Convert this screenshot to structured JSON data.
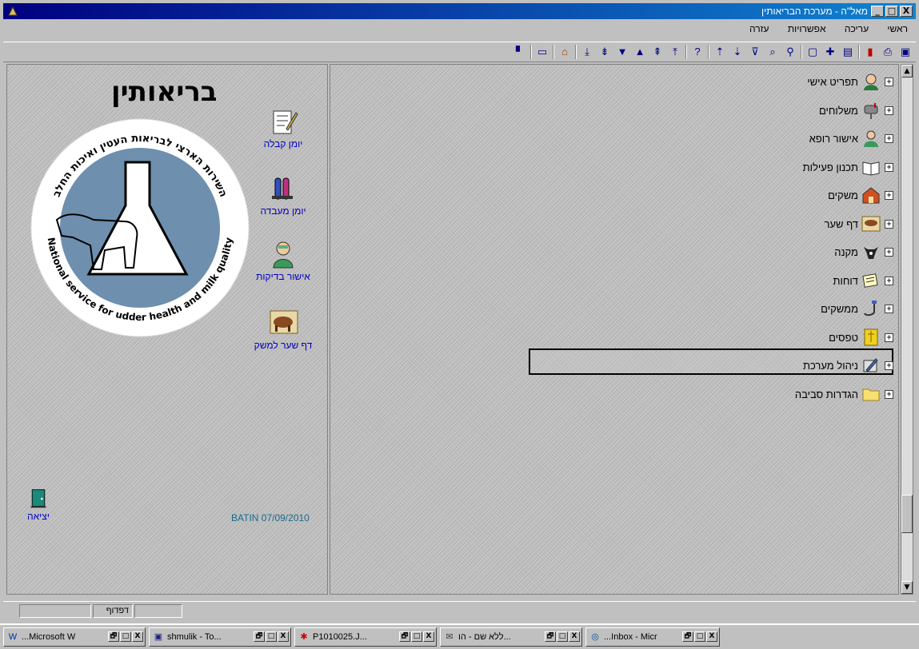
{
  "window": {
    "title": "מאל\"ה - מערכת הבריאותין",
    "buttons": {
      "minimize": "_",
      "maximize": "□",
      "close": "X"
    }
  },
  "menu": {
    "items": [
      "ראשי",
      "עריכה",
      "אפשרויות",
      "עזרה"
    ]
  },
  "toolbar": {
    "icons": [
      "window-icon",
      "print-preview-icon",
      "chart-icon",
      "note-icon",
      "new-icon",
      "document-icon",
      "filter-icon",
      "sort-desc-icon",
      "sort-asc-icon",
      "help-icon",
      "first-icon",
      "prev-page-icon",
      "up-icon",
      "down-icon",
      "next-page-icon",
      "last-icon",
      "home-icon",
      "display-icon",
      "bookmark-icon"
    ]
  },
  "left": {
    "brand_title": "בריאותין",
    "logo_text_outer": "השירות הארצי לבריאות העטין ואיכות החלב",
    "logo_text_english": "National service for udder health and milk quality",
    "shortcuts": [
      {
        "label": "יומן קבלה"
      },
      {
        "label": "יומן מעבדה"
      },
      {
        "label": "אישור בדיקות"
      },
      {
        "label": "דף שער למשק"
      }
    ],
    "status_date": "BATIN 07/09/2010",
    "exit_label": "יציאה"
  },
  "tree": {
    "items": [
      {
        "label": "תפריט אישי",
        "icon": "user-icon"
      },
      {
        "label": "משלוחים",
        "icon": "mailbox-icon"
      },
      {
        "label": "אישור רופא",
        "icon": "doctor-icon"
      },
      {
        "label": "תכנון פעילות",
        "icon": "book-icon"
      },
      {
        "label": "משקים",
        "icon": "barn-icon"
      },
      {
        "label": "דף שער",
        "icon": "cow-icon"
      },
      {
        "label": "מקנה",
        "icon": "cattle-icon"
      },
      {
        "label": "דוחות",
        "icon": "reports-icon"
      },
      {
        "label": "ממשקים",
        "icon": "interface-icon"
      },
      {
        "label": "טפסים",
        "icon": "forms-icon"
      },
      {
        "label": "ניהול מערכת",
        "icon": "admin-icon",
        "selected": true
      },
      {
        "label": "הגדרות סביבה",
        "icon": "folder-icon"
      }
    ],
    "expander": "+"
  },
  "statusbar": {
    "field_label": "דפדוף"
  },
  "taskbar": {
    "tasks": [
      {
        "label": "...Microsoft W",
        "icon": "word-icon"
      },
      {
        "label": "shmulik - To...",
        "icon": "save-icon"
      },
      {
        "label": "P1010025.J...",
        "icon": "image-icon"
      },
      {
        "label": "ללא שם - הו...",
        "icon": "mail-icon"
      },
      {
        "label": "...Inbox - Micr",
        "icon": "outlook-icon"
      }
    ],
    "win_buttons": [
      "🗗",
      "□",
      "X"
    ]
  }
}
